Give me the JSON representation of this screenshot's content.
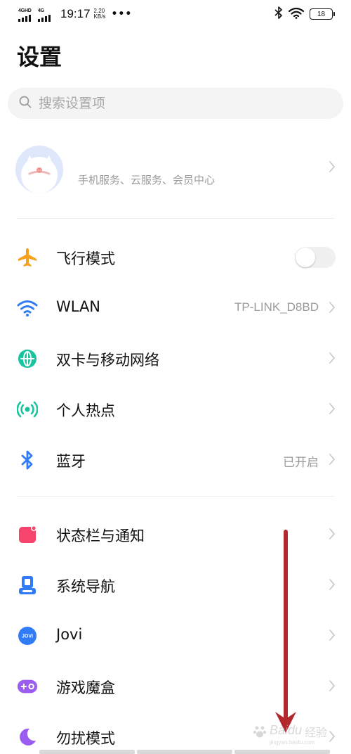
{
  "status_bar": {
    "sim1_label": "4GHD",
    "sim2_label": "4G",
    "time": "19:17",
    "speed_value": "2.20",
    "speed_unit": "KB/s",
    "more": "•••",
    "battery": "18"
  },
  "page_title": "设置",
  "search": {
    "placeholder": "搜索设置项"
  },
  "account": {
    "subtitle": "手机服务、云服务、会员中心"
  },
  "group1": [
    {
      "label": "飞行模式",
      "icon": "airplane-icon",
      "color": "#f5a11c",
      "toggle_on": false
    },
    {
      "label": "WLAN",
      "icon": "wifi-icon",
      "color": "#2f7cf6",
      "value": "TP-LINK_D8BD"
    },
    {
      "label": "双卡与移动网络",
      "icon": "globe-icon",
      "color": "#19c3a0"
    },
    {
      "label": "个人热点",
      "icon": "hotspot-icon",
      "color": "#19c3a0"
    },
    {
      "label": "蓝牙",
      "icon": "bluetooth-icon",
      "color": "#2f7cf6",
      "value": "已开启"
    }
  ],
  "group2": [
    {
      "label": "状态栏与通知",
      "icon": "notification-icon",
      "color": "#f5456c"
    },
    {
      "label": "系统导航",
      "icon": "navigation-icon",
      "color": "#2f7cf6"
    },
    {
      "label": "Jovi",
      "icon": "jovi-icon",
      "color": "#2f7cf6",
      "icon_text": "JOVI"
    },
    {
      "label": "游戏魔盒",
      "icon": "game-box-icon",
      "color": "#9b5cf0"
    },
    {
      "label": "勿扰模式",
      "icon": "moon-icon",
      "color": "#9b5cf0"
    }
  ],
  "annotation_arrow_color": "#b3282d",
  "watermark": {
    "brand": "Baidu",
    "suffix": "经验",
    "url": "jingyan.baidu.com"
  }
}
